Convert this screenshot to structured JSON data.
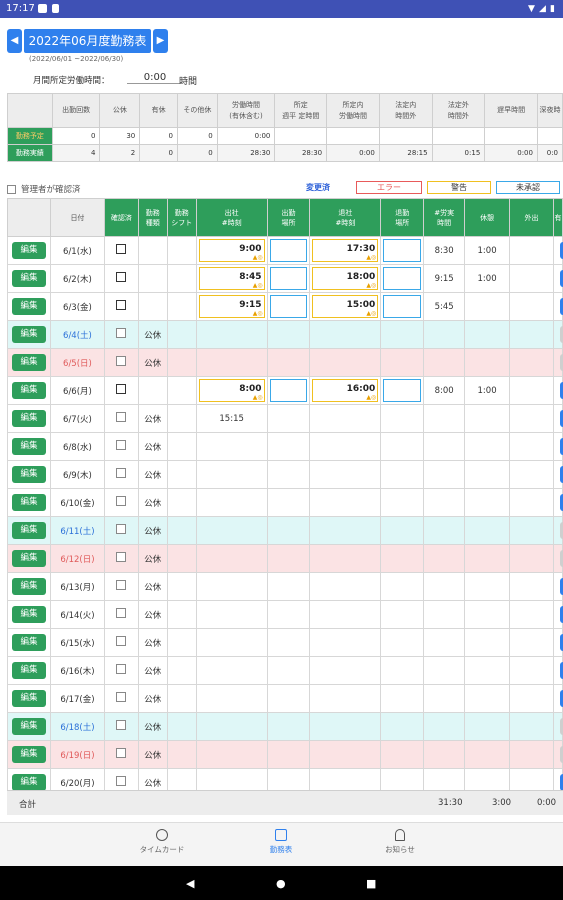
{
  "status_bar": {
    "time": "17:17"
  },
  "header": {
    "prev": "◀",
    "next": "▶",
    "title": "2022年06月度勤務表",
    "range": "(2022/06/01 ~2022/06/30)",
    "monthly_label": "月間所定労働時間：",
    "monthly_value": "0:00",
    "monthly_unit": "時間"
  },
  "summary": {
    "headers": [
      "出勤回数",
      "公休",
      "有休",
      "その他休",
      "労働時間\n(有休含む)",
      "所定\n週平 定時間",
      "所定内\n労働時間",
      "法定内\n時間外",
      "法定外\n時間外",
      "遅早時間",
      "深夜時"
    ],
    "rows": [
      {
        "label": "勤務予定",
        "values": [
          "0",
          "30",
          "0",
          "0",
          "0:00",
          "",
          "",
          "",
          "",
          "",
          ""
        ]
      },
      {
        "label": "勤務実績",
        "values": [
          "4",
          "2",
          "0",
          "0",
          "28:30",
          "28:30",
          "0:00",
          "28:15",
          "0:15",
          "0:00",
          "0:0"
        ]
      }
    ]
  },
  "approval": {
    "label": "管理者が確認済"
  },
  "legend": [
    {
      "label": "変更済",
      "color": "#ffffff",
      "border": "#ffffff",
      "text": "#2b5fd8"
    },
    {
      "label": "エラー",
      "color": "#ffffff",
      "border": "#e85a5a",
      "text": "#e85a5a"
    },
    {
      "label": "警告",
      "color": "#ffffff",
      "border": "#f0c020",
      "text": "#333333"
    },
    {
      "label": "未承認",
      "color": "#ffffff",
      "border": "#3aa8e8",
      "text": "#333333"
    }
  ],
  "table": {
    "headers": [
      "",
      "日付",
      "確認済",
      "勤務\n種類",
      "勤務\nシフト",
      "出社\n#時刻",
      "出勤\n場所",
      "退社\n#時刻",
      "退勤\n場所",
      "#労実\n時間",
      "休憩",
      "外出",
      "有"
    ],
    "edit_label": "編集",
    "rows": [
      {
        "date": "6/1(水)",
        "type": "",
        "in": "9:00",
        "out": "17:30",
        "work": "8:30",
        "break": "1:00",
        "kind": "weekday",
        "editable": true
      },
      {
        "date": "6/2(木)",
        "type": "",
        "in": "8:45",
        "out": "18:00",
        "work": "9:15",
        "break": "1:00",
        "kind": "weekday",
        "editable": true
      },
      {
        "date": "6/3(金)",
        "type": "",
        "in": "9:15",
        "out": "15:00",
        "work": "5:45",
        "break": "",
        "kind": "weekday",
        "editable": true
      },
      {
        "date": "6/4(土)",
        "type": "公休",
        "in": "",
        "out": "",
        "work": "",
        "break": "",
        "kind": "sat",
        "editable": false
      },
      {
        "date": "6/5(日)",
        "type": "公休",
        "in": "",
        "out": "",
        "work": "",
        "break": "",
        "kind": "sun",
        "editable": false
      },
      {
        "date": "6/6(月)",
        "type": "",
        "in": "8:00",
        "out": "16:00",
        "work": "8:00",
        "break": "1:00",
        "kind": "weekday",
        "editable": true
      },
      {
        "date": "6/7(火)",
        "type": "公休",
        "in_text": "15:15",
        "in": "",
        "out": "",
        "work": "",
        "break": "",
        "kind": "weekday",
        "editable": false
      },
      {
        "date": "6/8(水)",
        "type": "公休",
        "in": "",
        "out": "",
        "work": "",
        "break": "",
        "kind": "weekday",
        "editable": false
      },
      {
        "date": "6/9(木)",
        "type": "公休",
        "in": "",
        "out": "",
        "work": "",
        "break": "",
        "kind": "weekday",
        "editable": false
      },
      {
        "date": "6/10(金)",
        "type": "公休",
        "in": "",
        "out": "",
        "work": "",
        "break": "",
        "kind": "weekday",
        "editable": false
      },
      {
        "date": "6/11(土)",
        "type": "公休",
        "in": "",
        "out": "",
        "work": "",
        "break": "",
        "kind": "sat",
        "editable": false
      },
      {
        "date": "6/12(日)",
        "type": "公休",
        "in": "",
        "out": "",
        "work": "",
        "break": "",
        "kind": "sun",
        "editable": false
      },
      {
        "date": "6/13(月)",
        "type": "公休",
        "in": "",
        "out": "",
        "work": "",
        "break": "",
        "kind": "weekday",
        "editable": false
      },
      {
        "date": "6/14(火)",
        "type": "公休",
        "in": "",
        "out": "",
        "work": "",
        "break": "",
        "kind": "weekday",
        "editable": false
      },
      {
        "date": "6/15(水)",
        "type": "公休",
        "in": "",
        "out": "",
        "work": "",
        "break": "",
        "kind": "weekday",
        "editable": false
      },
      {
        "date": "6/16(木)",
        "type": "公休",
        "in": "",
        "out": "",
        "work": "",
        "break": "",
        "kind": "weekday",
        "editable": false
      },
      {
        "date": "6/17(金)",
        "type": "公休",
        "in": "",
        "out": "",
        "work": "",
        "break": "",
        "kind": "weekday",
        "editable": false
      },
      {
        "date": "6/18(土)",
        "type": "公休",
        "in": "",
        "out": "",
        "work": "",
        "break": "",
        "kind": "sat",
        "editable": false
      },
      {
        "date": "6/19(日)",
        "type": "公休",
        "in": "",
        "out": "",
        "work": "",
        "break": "",
        "kind": "sun",
        "editable": false
      },
      {
        "date": "6/20(月)",
        "type": "公休",
        "in": "",
        "out": "",
        "work": "",
        "break": "",
        "kind": "weekday",
        "editable": false
      }
    ]
  },
  "footer": {
    "label": "合計",
    "work_total": "31:30",
    "break_total": "3:00",
    "out_total": "0:00"
  },
  "tabs": [
    {
      "label": "タイムカード",
      "icon": "alarm-clock-icon",
      "active": false
    },
    {
      "label": "勤務表",
      "icon": "calendar-icon",
      "active": true
    },
    {
      "label": "お知らせ",
      "icon": "bell-icon",
      "active": false
    }
  ],
  "colors": {
    "primary": "#2f80ed",
    "green": "#2e9e5b",
    "sat_bg": "#dff7f7",
    "sun_bg": "#fbe3e4"
  }
}
